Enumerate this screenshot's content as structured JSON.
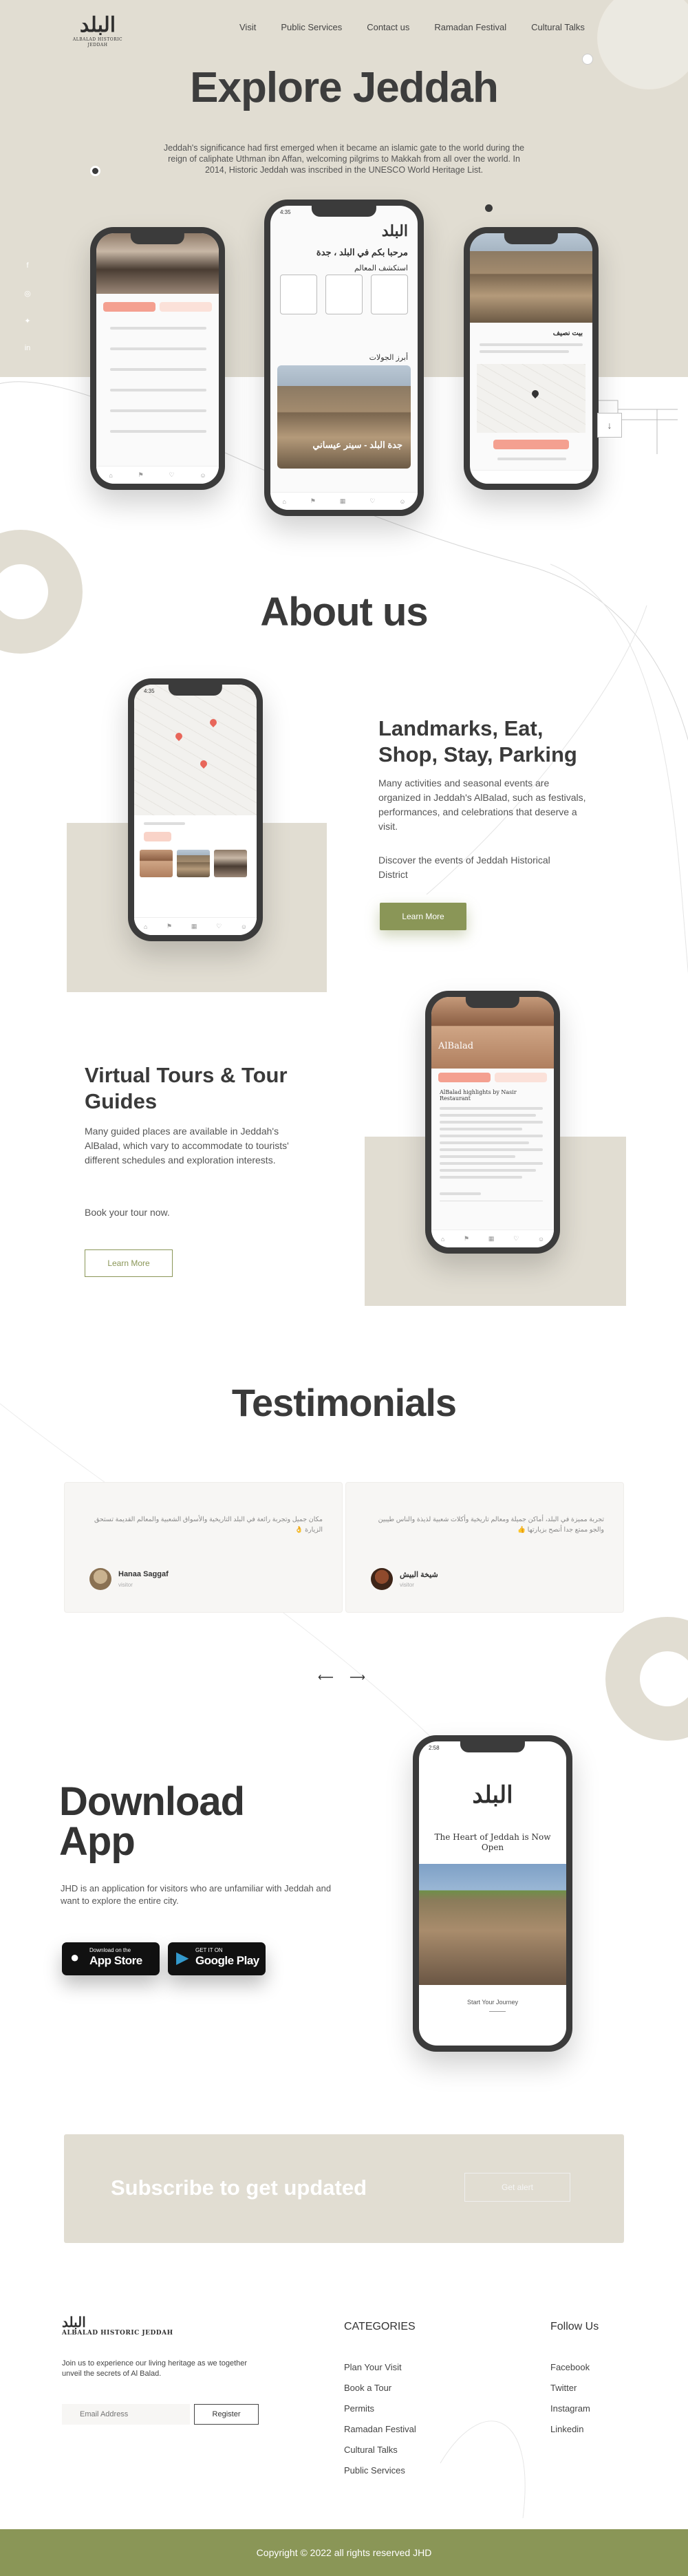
{
  "brand": {
    "logo_ar": "البلد",
    "logo_en": "ALBALAD HISTORIC JEDDAH"
  },
  "nav": {
    "items": [
      "Visit",
      "Public Services",
      "Contact us",
      "Ramadan Festival",
      "Cultural Talks"
    ]
  },
  "hero": {
    "title": "Explore Jeddah",
    "text": "Jeddah's significance had first emerged when it became an islamic gate to the world during the reign of caliphate Uthman ibn Affan, welcoming pilgrims to Makkah from all over the world. In 2014, Historic Jeddah was inscribed in the UNESCO World Heritage List."
  },
  "social": {
    "icons": [
      "facebook-icon",
      "instagram-icon",
      "twitter-icon",
      "linkedin-icon"
    ]
  },
  "phones": {
    "center_greeting": "مرحبا بكم في البلد ، جدة",
    "center_section1": "استكشف المعالم",
    "center_section2": "أبرز الجولات",
    "center_photo_caption": "جدة البلد - سينر عيساني",
    "right_title": "بيت نصيف",
    "about_header": "AlBalad highlights by Nasir Restaurant",
    "about_brand": "AlBalad",
    "download_tagline": "The Heart of Jeddah is Now Open",
    "download_cta": "Start Your Journey",
    "download_logo_ar": "البلد",
    "time": "4:35",
    "time2": "2:58"
  },
  "about": {
    "title": "About us",
    "feature1": {
      "title": "Landmarks, Eat, Shop, Stay, Parking",
      "text": "Many activities and seasonal events are organized in Jeddah's AlBalad, such as festivals, performances, and celebrations that deserve a visit.",
      "text2": "Discover the events of Jeddah Historical District",
      "button": "Learn More"
    },
    "feature2": {
      "title": "Virtual Tours & Tour Guides",
      "text": "Many guided places are available in Jeddah's AlBalad, which vary to accommodate to tourists' different schedules and exploration interests.",
      "text2": "Book your tour now.",
      "button": "Learn More"
    }
  },
  "testimonials": {
    "title": "Testimonials",
    "items": [
      {
        "quote": "مكان جميل وتجربة رائعة في البلد التاريخية والأسواق الشعبية والمعالم القديمة تستحق الزيارة 👌",
        "name": "Hanaa Saggaf",
        "role": "visitor"
      },
      {
        "quote": "تجربة مميزة في البلد، أماكن جميلة ومعالم تاريخية وأكلات شعبية لذيذة والناس طيبين والجو ممتع جدا أنصح بزيارتها 👍",
        "name": "شيخة البيش",
        "role": "visitor"
      }
    ]
  },
  "download": {
    "title": "Download App",
    "text": "JHD is an application for visitors who are unfamiliar with Jeddah and want to explore the entire city.",
    "appstore_small": "Download on the",
    "appstore_big": "App Store",
    "googleplay_small": "GET IT ON",
    "googleplay_big": "Google Play"
  },
  "subscribe": {
    "title": "Subscribe to get updated",
    "button": "Get alert"
  },
  "footer": {
    "tagline": "Join us to experience our living heritage as we together unveil the secrets of Al Balad.",
    "email_placeholder": "Email Address",
    "register": "Register",
    "categories_title": "CATEGORIES",
    "categories": [
      "Plan Your Visit",
      "Book a Tour",
      "Permits",
      "Ramadan Festival",
      "Cultural Talks",
      "Public Services"
    ],
    "follow_title": "Follow Us",
    "follow": [
      "Facebook",
      "Twitter",
      "Instagram",
      "Linkedin"
    ],
    "copyright": "Copyright © 2022 all rights reserved JHD"
  },
  "colors": {
    "accent": "#8a9657",
    "beige": "#e1ddd2",
    "dark": "#3b3b3b",
    "coral": "#f4a090"
  }
}
